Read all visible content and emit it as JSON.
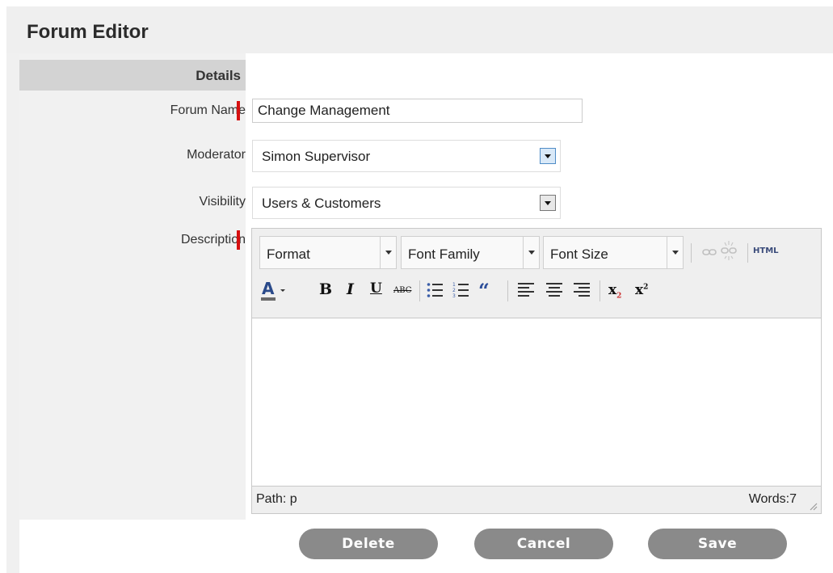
{
  "header": {
    "title": "Forum Editor"
  },
  "section": {
    "title": "Details"
  },
  "fields": {
    "forum_name": {
      "label": "Forum Name",
      "value": "Change Management"
    },
    "moderator": {
      "label": "Moderator",
      "value": "Simon Supervisor"
    },
    "visibility": {
      "label": "Visibility",
      "value": "Users & Customers"
    },
    "description": {
      "label": "Description"
    }
  },
  "editor": {
    "format_label": "Format",
    "font_family_label": "Font Family",
    "font_size_label": "Font Size",
    "html_label": "HTML",
    "path_text": "Path: p",
    "word_count_text": "Words:7",
    "icons": [
      "link-icon",
      "unlink-icon",
      "html-source-icon",
      "text-color-icon",
      "bold-icon",
      "italic-icon",
      "underline-icon",
      "strikethrough-icon",
      "bullet-list-icon",
      "numbered-list-icon",
      "blockquote-icon",
      "align-left-icon",
      "align-center-icon",
      "align-right-icon",
      "subscript-icon",
      "superscript-icon"
    ]
  },
  "buttons": {
    "delete": "Delete",
    "cancel": "Cancel",
    "save": "Save"
  },
  "colors": {
    "required": "#d60f0f",
    "button": "#8a8a8a",
    "header_bg": "#efefef",
    "label_bg": "#f1f1f1",
    "section_bg": "#d3d3d3"
  }
}
